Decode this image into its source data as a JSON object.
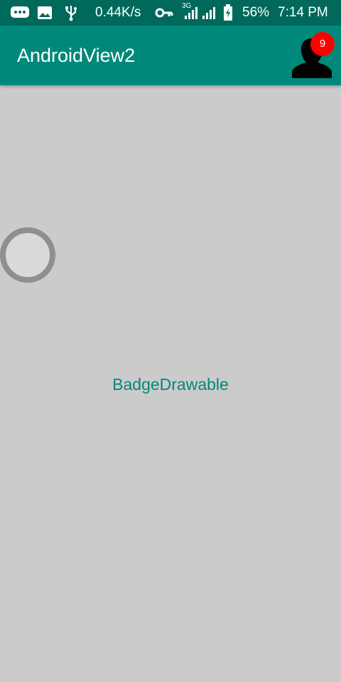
{
  "status_bar": {
    "network_speed": "0.44K/s",
    "network_type": "3G",
    "battery": "56%",
    "time": "7:14 PM",
    "icons": [
      "chat-notification-icon",
      "image-notification-icon",
      "usb-icon",
      "vpn-key-icon",
      "signal-icon",
      "signal-icon",
      "battery-icon"
    ]
  },
  "app_bar": {
    "title": "AndroidView2",
    "badge_count": "9",
    "avatar_icon": "person-silhouette-icon"
  },
  "main": {
    "label": "BadgeDrawable"
  },
  "colors": {
    "status_bar": "#00695c",
    "app_bar": "#00897b",
    "background": "#cbcbcb",
    "accent": "#00897b",
    "badge": "#ff0000",
    "ring": "#8f8f8f"
  }
}
